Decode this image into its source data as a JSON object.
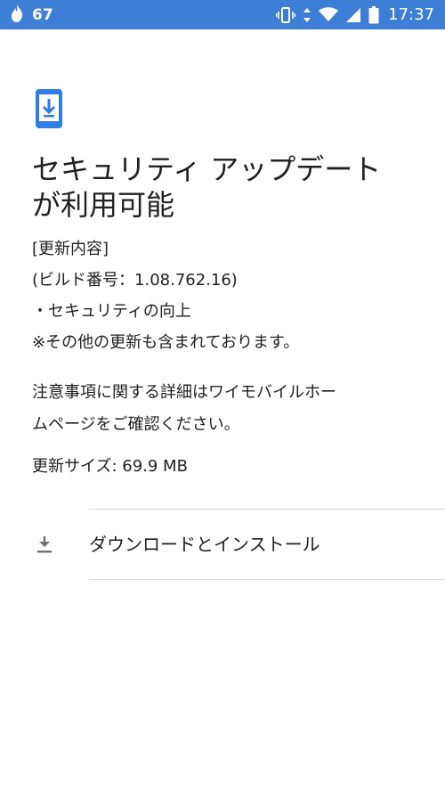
{
  "status_bar": {
    "notification_count": "67",
    "time": "17:37",
    "icons": [
      "flame-icon",
      "vibrate-icon",
      "data-arrows-icon",
      "wifi-icon",
      "signal-icon",
      "battery-icon"
    ]
  },
  "header_icon": "phone-download-icon",
  "title_lines": [
    "セキュリティ アップデート",
    "が利用可能"
  ],
  "details": {
    "heading": "[更新内容]",
    "build": "(ビルド番号：1.08.762.16)",
    "bullet": "・セキュリティの向上",
    "note": "※その他の更新も含まれております。"
  },
  "notice_lines": [
    "注意事項に関する詳細はワイモバイルホー",
    "ムページをご確認ください。"
  ],
  "update_size": "更新サイズ: 69.9 MB",
  "action": {
    "label": "ダウンロードとインストール",
    "icon": "download-icon"
  },
  "colors": {
    "status_bar": "#3d7fd6",
    "accent": "#2f7ce4",
    "icon_gray": "#707070",
    "divider": "#dcdcdc"
  }
}
